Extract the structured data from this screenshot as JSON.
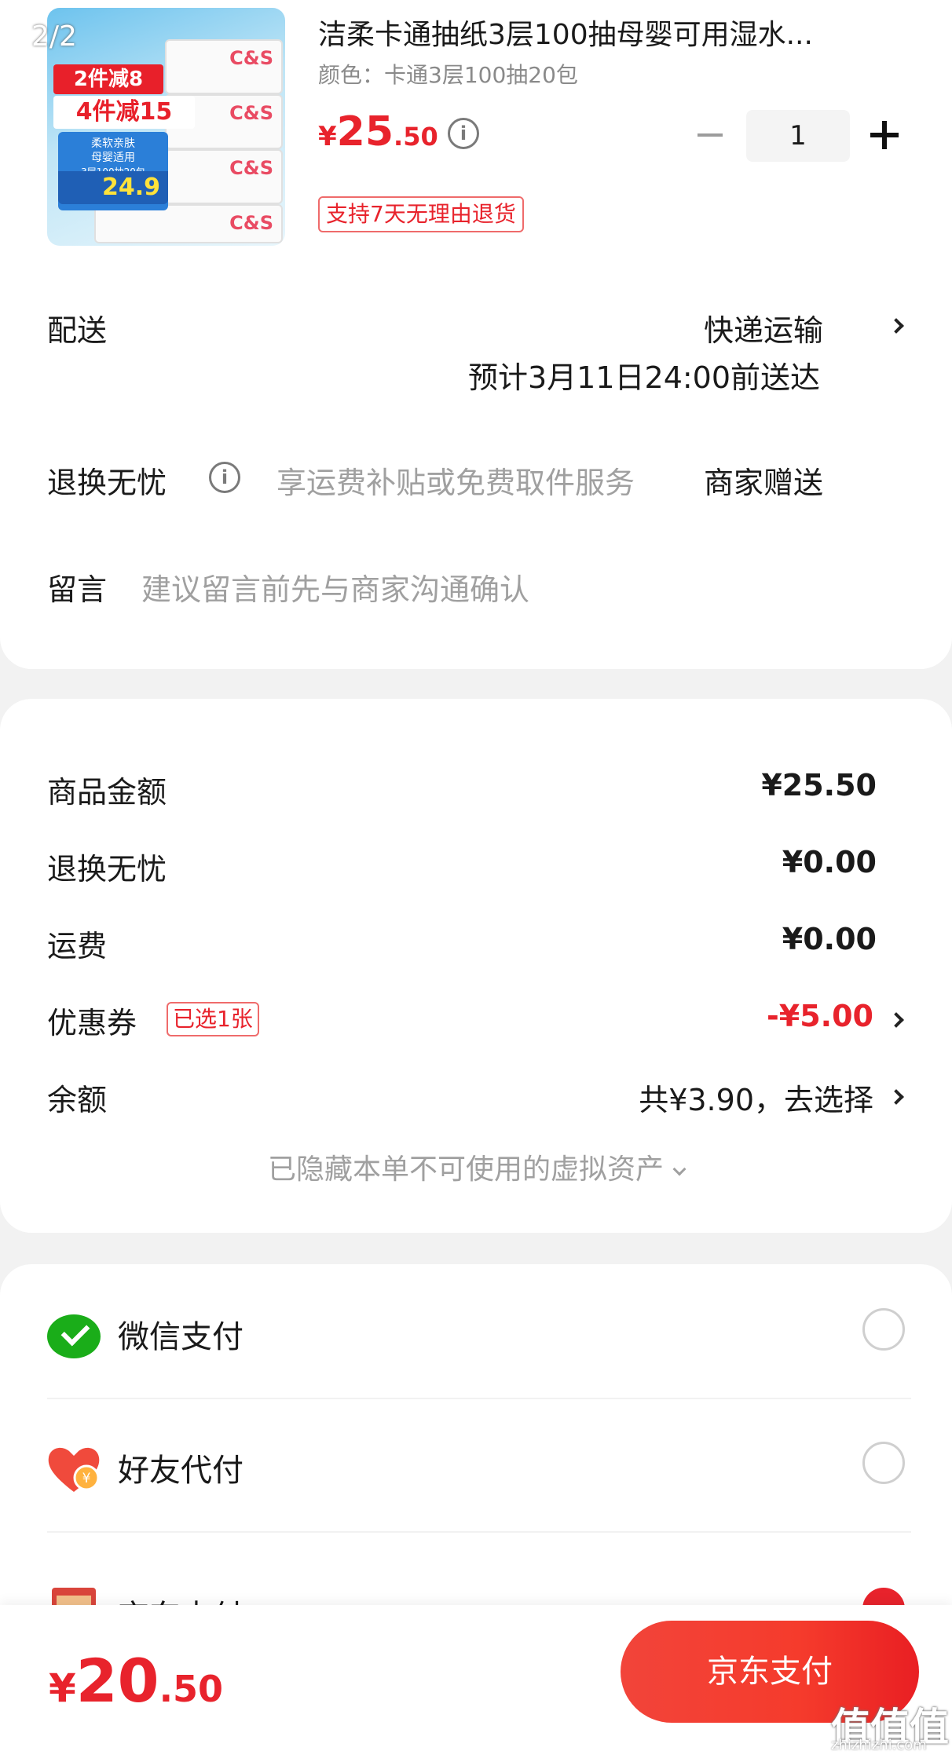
{
  "product": {
    "title": "洁柔卡通抽纸3层100抽母婴可用湿水...",
    "spec": "颜色：卡通3层100抽20包",
    "price_symbol": "¥",
    "price_int": "25",
    "price_dec": ".50",
    "quantity": "1",
    "return_badge": "支持7天无理由退货",
    "image": {
      "tag1": "2件减8",
      "tag2": "4件减15",
      "panel_line1": "柔软亲肤",
      "panel_line2": "母婴适用",
      "panel_line3": "3层100抽20包",
      "price": "24.9"
    }
  },
  "page_counter": "2/2",
  "delivery": {
    "label": "配送",
    "method": "快递运输",
    "eta": "预计3月11日24:00前送达"
  },
  "returns": {
    "label": "退换无忧",
    "desc": "享运费补贴或免费取件服务",
    "value": "商家赠送"
  },
  "message": {
    "label": "留言",
    "placeholder": "建议留言前先与商家沟通确认"
  },
  "summary": {
    "goods_label": "商品金额",
    "goods_value": "¥25.50",
    "returns_label": "退换无忧",
    "returns_value": "¥0.00",
    "shipping_label": "运费",
    "shipping_value": "¥0.00",
    "coupon_label": "优惠券",
    "coupon_badge": "已选1张",
    "coupon_value": "-¥5.00",
    "balance_label": "余额",
    "balance_value": "共¥3.90，去选择",
    "hidden_note": "已隐藏本单不可使用的虚拟资产"
  },
  "payment": {
    "methods": [
      {
        "label": "微信支付",
        "icon": "wechat-pay-icon",
        "selected": false
      },
      {
        "label": "好友代付",
        "icon": "friend-pay-icon",
        "selected": false
      },
      {
        "label": "京东支付",
        "icon": "jd-pay-icon",
        "selected": true
      }
    ]
  },
  "footer": {
    "total_symbol": "¥",
    "total_int": "20",
    "total_dec": ".50",
    "pay_button": "京东支付"
  },
  "watermark": {
    "badge": "值值值",
    "url": "zhizhizhi.com"
  },
  "colors": {
    "accent_red": "#e8232c",
    "wechat_green": "#1aad19",
    "muted_text": "#a0a0a0"
  }
}
